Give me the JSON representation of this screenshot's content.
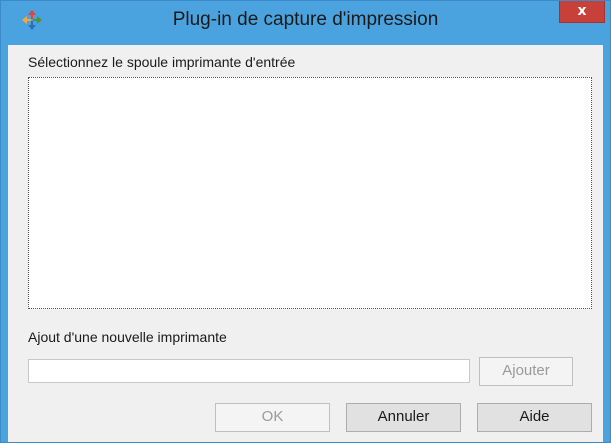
{
  "window": {
    "title": "Plug-in de capture d'impression",
    "close_label": "x",
    "colors": {
      "frame": "#4aa3de",
      "close": "#c7403a",
      "client": "#f0f0f0"
    }
  },
  "spool": {
    "label": "Sélectionnez le spoule imprimante d'entrée"
  },
  "add_printer": {
    "label": "Ajout d'une nouvelle imprimante",
    "input_value": "",
    "add_label": "Ajouter"
  },
  "buttons": {
    "ok_label": "OK",
    "cancel_label": "Annuler",
    "help_label": "Aide"
  }
}
